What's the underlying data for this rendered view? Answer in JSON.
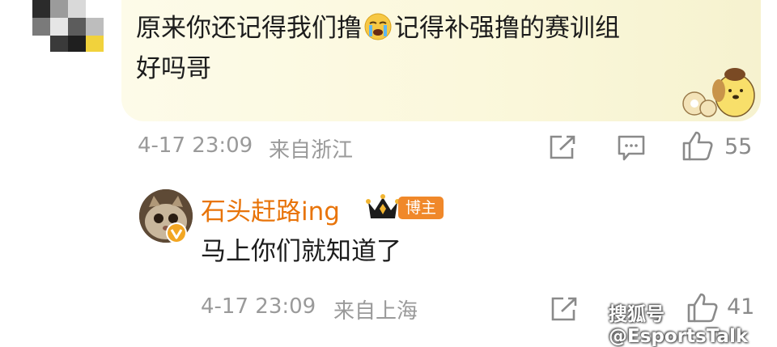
{
  "comment": {
    "text_line1_a": "原来你还记得我们撸",
    "emoji": "loudly-crying-face",
    "text_line1_b": "记得补强撸的赛训组",
    "text_line2": "好吗哥",
    "date": "4-17 23:09",
    "location": "来自浙江",
    "likes": "55"
  },
  "reply": {
    "username": "石头赶路ing",
    "badge": "博主",
    "text": "马上你们就知道了",
    "date": "4-17 23:09",
    "location": "来自上海",
    "likes": "41"
  },
  "watermark": "搜狐号@EsportsTalk",
  "colors": {
    "username": "#e8740a",
    "badge_bg": "#f0882a",
    "meta_gray": "#9a9a9a",
    "bubble_bg": "#fbf8dc"
  },
  "icons": [
    "share-icon",
    "comment-icon",
    "like-icon",
    "crown-icon",
    "verified-icon"
  ]
}
